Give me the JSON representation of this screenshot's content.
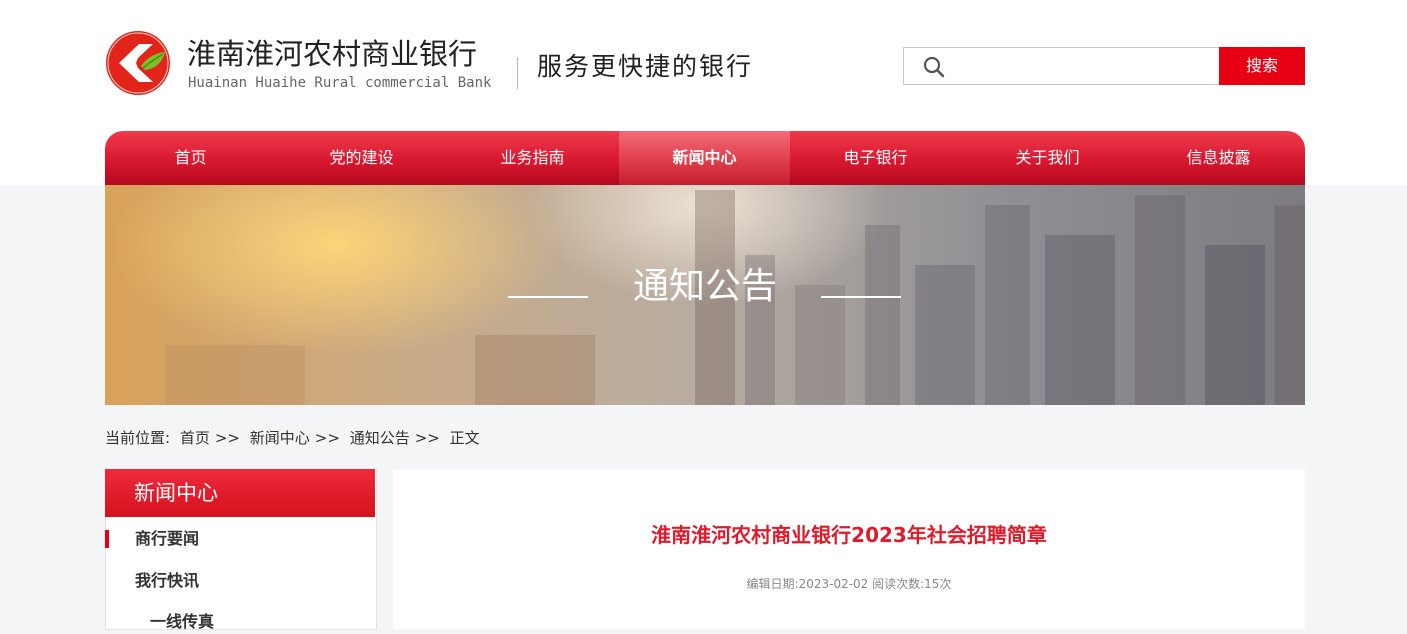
{
  "header": {
    "bank_name_cn": "淮南淮河农村商业银行",
    "bank_name_en": "Huainan Huaihe Rural commercial Bank",
    "slogan": "服务更快捷的银行",
    "search": {
      "placeholder": "",
      "button_label": "搜索"
    },
    "logo_icon": "bank-logo-icon",
    "search_icon": "search-icon"
  },
  "nav": {
    "items": [
      {
        "label": "首页"
      },
      {
        "label": "党的建设"
      },
      {
        "label": "业务指南"
      },
      {
        "label": "新闻中心"
      },
      {
        "label": "电子银行"
      },
      {
        "label": "关于我们"
      },
      {
        "label": "信息披露"
      }
    ],
    "active": "新闻中心"
  },
  "banner": {
    "title": "通知公告"
  },
  "breadcrumb": {
    "prefix": "当前位置:",
    "items": [
      "首页",
      "新闻中心",
      "通知公告",
      "正文"
    ],
    "separator": ">>"
  },
  "sidebar": {
    "title": "新闻中心",
    "items": [
      {
        "label": "商行要闻"
      },
      {
        "label": "我行快讯"
      },
      {
        "label": "一线传真"
      }
    ],
    "active": "商行要闻"
  },
  "article": {
    "title": "淮南淮河农村商业银行2023年社会招聘简章",
    "meta": "编辑日期:2023-02-02 阅读次数:15次"
  },
  "colors": {
    "brand_red": "#e60012",
    "nav_red": "#d81830",
    "title_red": "#e01a2b"
  }
}
